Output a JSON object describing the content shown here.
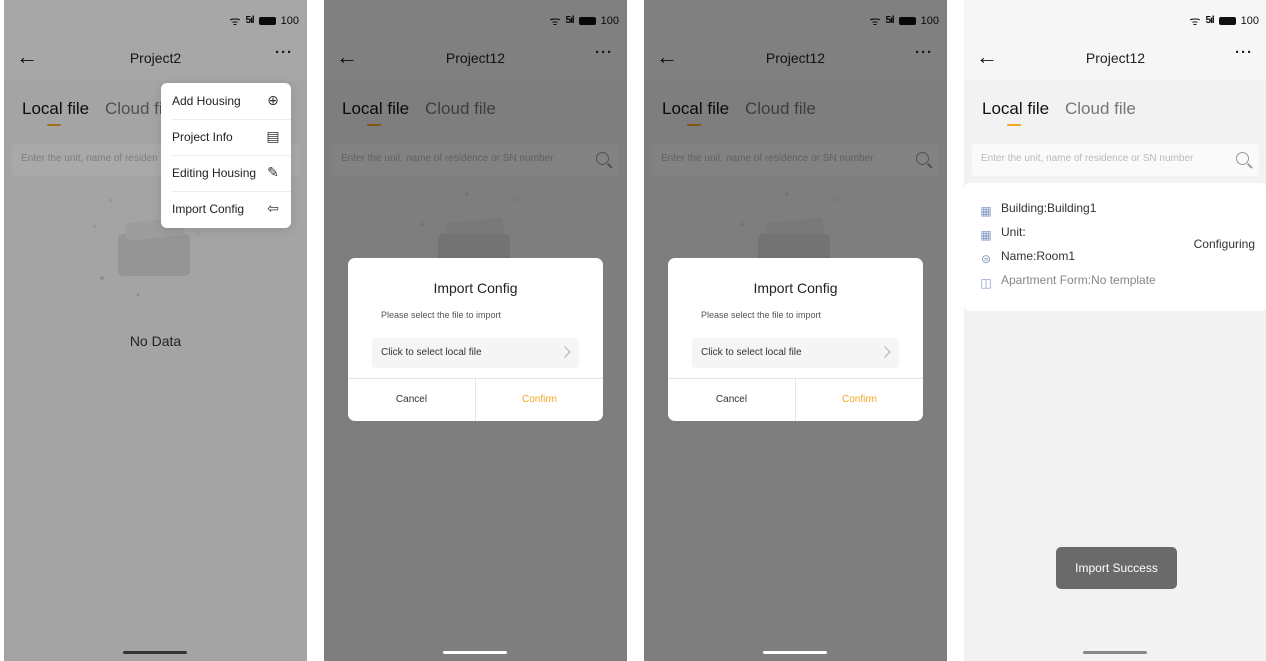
{
  "status": {
    "signal": "5ıl",
    "battery": "100"
  },
  "screens": {
    "s1": {
      "title": "Project2",
      "tabs": {
        "local": "Local file",
        "cloud": "Cloud fil"
      },
      "search_placeholder": "Enter the unit, name of residen",
      "empty_text": "No Data",
      "menu": [
        {
          "label": "Add Housing",
          "icon": "add-circle-icon"
        },
        {
          "label": "Project Info",
          "icon": "document-icon"
        },
        {
          "label": "Editing Housing",
          "icon": "edit-icon"
        },
        {
          "label": "Import Config",
          "icon": "import-icon"
        }
      ]
    },
    "s2": {
      "title": "Project12",
      "tabs": {
        "local": "Local file",
        "cloud": "Cloud file"
      },
      "search_placeholder": "Enter the unit, name of residence or SN number",
      "dialog": {
        "title": "Import Config",
        "subtitle": "Please select the file to import",
        "field": "Click to select local file",
        "cancel": "Cancel",
        "confirm": "Confirm"
      }
    },
    "s3": {
      "title": "Project12",
      "tabs": {
        "local": "Local file",
        "cloud": "Cloud file"
      },
      "search_placeholder": "Enter the unit, name of residence or SN number",
      "dialog": {
        "title": "Import Config",
        "subtitle": "Please select the file to import",
        "field": "Click to select local file",
        "cancel": "Cancel",
        "confirm": "Confirm"
      }
    },
    "s4": {
      "title": "Project12",
      "tabs": {
        "local": "Local file",
        "cloud": "Cloud file"
      },
      "search_placeholder": "Enter the unit, name of residence or SN number",
      "card": {
        "building": "Building:Building1",
        "unit": "Unit:",
        "name": "Name:Room1",
        "apartment_form": "Apartment Form:No template",
        "status": "Configuring"
      },
      "toast": "Import Success"
    }
  },
  "colors": {
    "accent": "#f5a623",
    "icon_blue": "#7f97c6"
  }
}
